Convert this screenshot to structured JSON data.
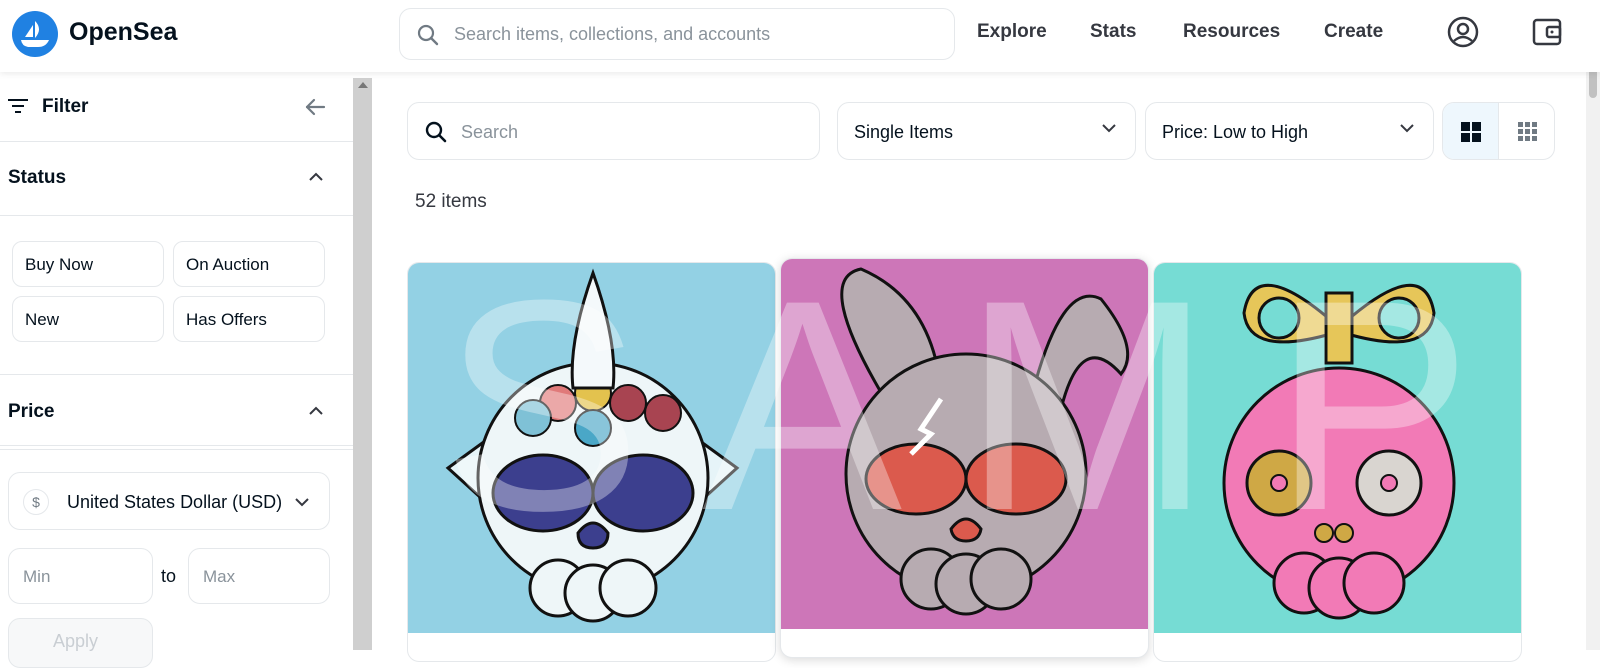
{
  "header": {
    "brand": "OpenSea",
    "search_placeholder": "Search items, collections, and accounts",
    "nav": [
      "Explore",
      "Stats",
      "Resources",
      "Create"
    ]
  },
  "sidebar": {
    "filter_label": "Filter",
    "status": {
      "title": "Status",
      "chips": [
        "Buy Now",
        "On Auction",
        "New",
        "Has Offers"
      ]
    },
    "price": {
      "title": "Price",
      "currency": "United States Dollar (USD)",
      "min_placeholder": "Min",
      "to": "to",
      "max_placeholder": "Max",
      "apply": "Apply"
    }
  },
  "main": {
    "search_placeholder": "Search",
    "item_type": "Single Items",
    "sort": "Price: Low to High",
    "item_count": "52 items",
    "watermark": "SAMPLE",
    "cards": [
      {
        "name": "fish-skull-card",
        "bg": "#93d1e4"
      },
      {
        "name": "bunny-skull-card",
        "bg": "#cd76b8"
      },
      {
        "name": "windup-skull-card",
        "bg": "#76dcd4"
      }
    ]
  },
  "colors": {
    "brand": "#2081e2",
    "border": "#e5e8eb",
    "muted": "#8a939b"
  }
}
